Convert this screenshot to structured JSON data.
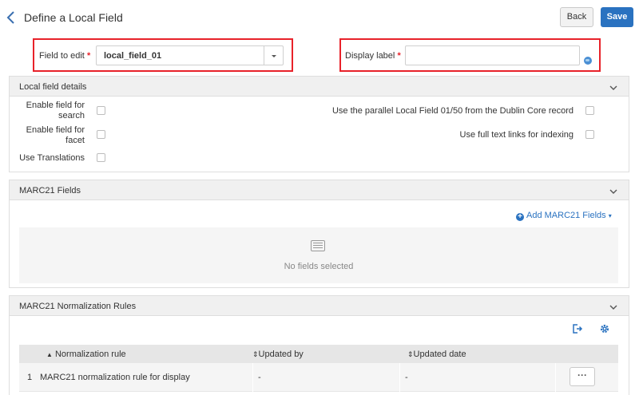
{
  "header": {
    "title": "Define a Local Field",
    "back_label": "Back",
    "save_label": "Save"
  },
  "form": {
    "field_to_edit_label": "Field to edit",
    "field_to_edit_value": "local_field_01",
    "display_label_label": "Display label",
    "display_label_value": "",
    "required_marker": "*"
  },
  "local_field_details": {
    "title": "Local field details",
    "enable_search_label": "Enable field for search",
    "enable_facet_label": "Enable field for facet",
    "use_translations_label": "Use Translations",
    "parallel_label": "Use the parallel Local Field 01/50 from the Dublin Core record",
    "full_text_label": "Use full text links for indexing"
  },
  "marc21_fields": {
    "title": "MARC21 Fields",
    "add_label": "Add MARC21 Fields",
    "empty_text": "No fields selected"
  },
  "normalization": {
    "title": "MARC21 Normalization Rules",
    "columns": [
      "Normalization rule",
      "Updated by",
      "Updated date"
    ],
    "rows": [
      {
        "index": "1",
        "rule": "MARC21 normalization rule for display",
        "updated_by": "-",
        "updated_date": "-"
      }
    ],
    "more_label": "···"
  },
  "colors": {
    "accent": "#2a72c0",
    "highlight": "#e8222a"
  }
}
